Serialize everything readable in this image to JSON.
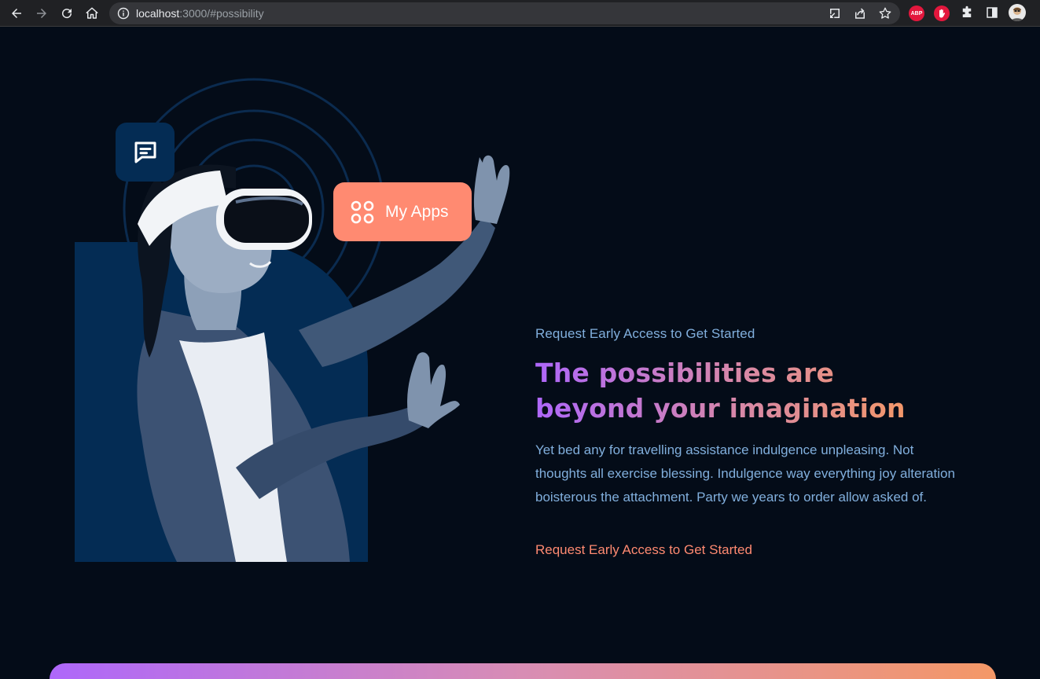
{
  "browser": {
    "url_host": "localhost",
    "url_rest": ":3000/#possibility",
    "extensions": [
      {
        "name": "adblock-plus",
        "label": "ABP",
        "color": "#e3173d"
      },
      {
        "name": "ublock",
        "label": "",
        "color": "#e3173d"
      }
    ]
  },
  "possibility": {
    "eyebrow": "Request Early Access to Get Started",
    "headline_line1": "The possibilities are",
    "headline_line2": "beyond your imagination",
    "body": "Yet bed any for travelling assistance indulgence unpleasing. Not thoughts all exercise blessing. Indulgence way everything joy alteration boisterous the attachment. Party we years to order allow asked of.",
    "cta": "Request Early Access to Get Started",
    "apps_card_label": "My Apps"
  },
  "colors": {
    "background": "#040c18",
    "accent_blue_text": "#81afdd",
    "accent_orange": "#ff8a71",
    "gradient_start": "#ae67fa",
    "gradient_end": "#f49867",
    "panel_blue": "#042c54"
  }
}
